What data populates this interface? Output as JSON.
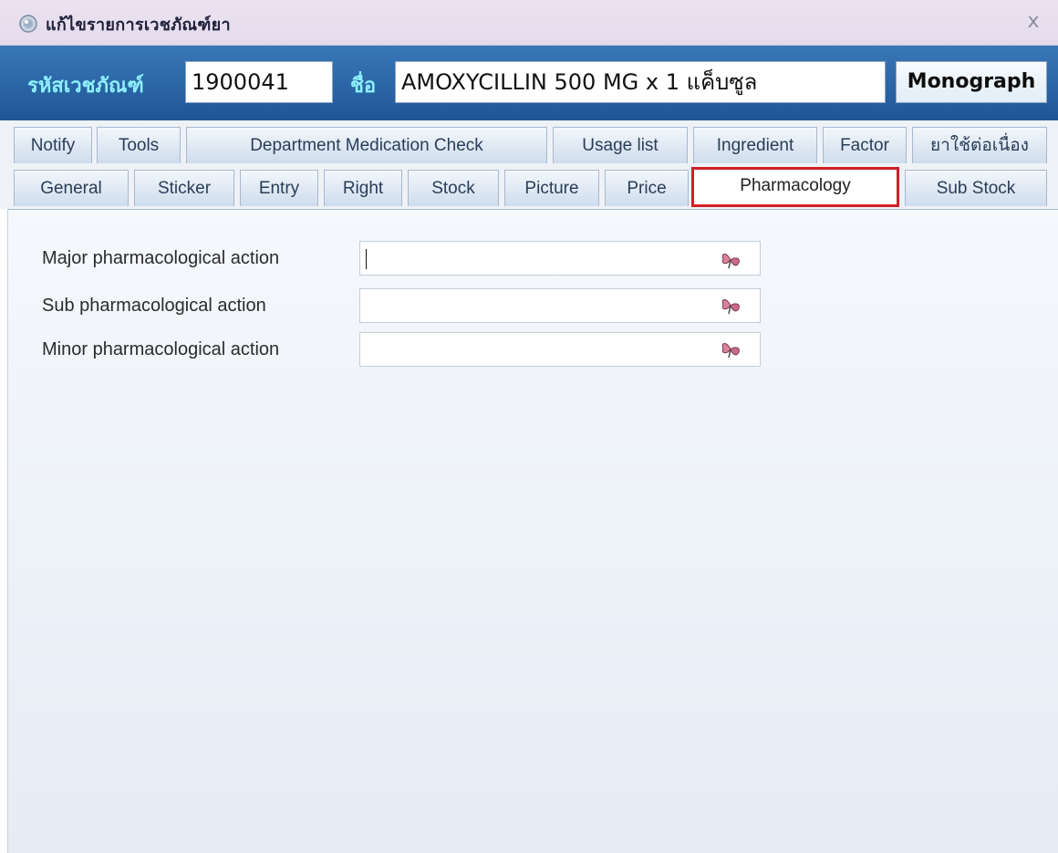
{
  "window": {
    "title": "แก้ไขรายการเวชภัณฑ์ยา",
    "close_glyph": "x"
  },
  "header": {
    "code_label": "รหัสเวชภัณฑ์",
    "code_value": "1900041",
    "name_label": "ชื่อ",
    "name_value": "AMOXYCILLIN 500 MG x 1 แค็บซูล",
    "monograph_label": "Monograph"
  },
  "tabs_row1": [
    {
      "label": "Notify"
    },
    {
      "label": "Tools"
    },
    {
      "label": "Department Medication Check"
    },
    {
      "label": "Usage list"
    },
    {
      "label": "Ingredient"
    },
    {
      "label": "Factor"
    },
    {
      "label": "ยาใช้ต่อเนื่อง"
    }
  ],
  "tabs_row2": [
    {
      "label": "General"
    },
    {
      "label": "Sticker"
    },
    {
      "label": "Entry"
    },
    {
      "label": "Right"
    },
    {
      "label": "Stock"
    },
    {
      "label": "Picture"
    },
    {
      "label": "Price"
    },
    {
      "label": "Pharmacology",
      "active": true
    },
    {
      "label": "Sub Stock"
    }
  ],
  "form": {
    "major_label": "Major pharmacological action",
    "major_value": "",
    "sub_label": "Sub pharmacological action",
    "sub_value": "",
    "minor_label": "Minor pharmacological action",
    "minor_value": ""
  },
  "colors": {
    "header_bg": "#2a66a8",
    "header_label": "#8df0ff",
    "active_tab_border": "#d21f27"
  },
  "icons": {
    "title": "drug-record-icon",
    "lookup": "butterfly-lookup-icon",
    "close": "close-icon"
  }
}
